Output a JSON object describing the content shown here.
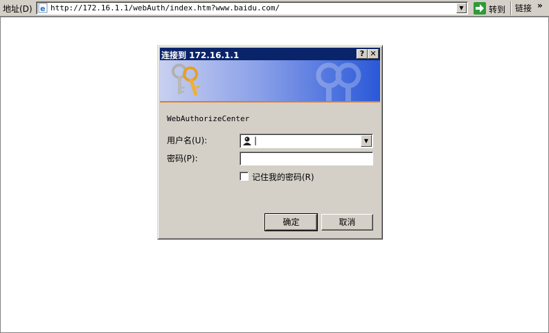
{
  "address_bar": {
    "label": "地址(D)",
    "url": "http://172.16.1.1/webAuth/index.htm?www.baidu.com/",
    "go_label": "转到",
    "links_label": "链接",
    "links_chevron": "»"
  },
  "dialog": {
    "title": "连接到 172.16.1.1",
    "help_glyph": "?",
    "close_glyph": "✕",
    "server_name": "WebAuthorizeCenter",
    "user_label": "用户名(U):",
    "user_value": "|",
    "password_label": "密码(P):",
    "remember_label": "记住我的密码(R)",
    "ok_label": "确定",
    "cancel_label": "取消"
  },
  "icons": {
    "ie_logo": "ie-page-icon",
    "go": "green-arrow-icon",
    "keys": "keys-icon",
    "user": "user-icon",
    "dropdown": "chevron-down-icon"
  },
  "colors": {
    "titlebar": "#0a246a",
    "face": "#d4d0c8",
    "banner_accent": "#e07a2a"
  }
}
